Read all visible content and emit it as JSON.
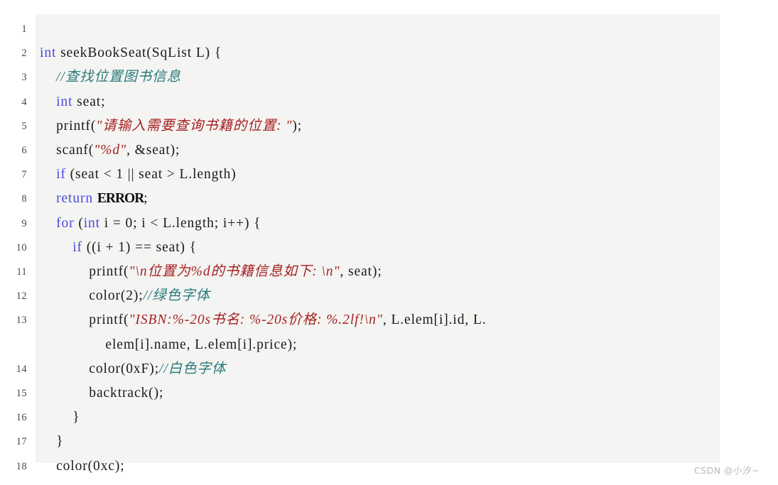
{
  "listing": {
    "language": "C",
    "background_color": "#f4f4f2",
    "gutter_color": "#4a4a4a",
    "colors": {
      "keyword": "#4a4ae0",
      "string": "#a52222",
      "comment": "#2a7a7a",
      "plain": "#1a1a1a"
    },
    "rows": [
      {
        "number": "1",
        "segments": []
      },
      {
        "number": "2",
        "segments": [
          {
            "cls": "kw",
            "text": "int"
          },
          {
            "cls": "plain",
            "text": " seekBookSeat(SqList L) {"
          }
        ]
      },
      {
        "number": "3",
        "segments": [
          {
            "cls": "plain",
            "text": "    "
          },
          {
            "cls": "cmt",
            "text": "//查找位置图书信息"
          }
        ]
      },
      {
        "number": "4",
        "segments": [
          {
            "cls": "plain",
            "text": "    "
          },
          {
            "cls": "kw",
            "text": "int"
          },
          {
            "cls": "plain",
            "text": " seat;"
          }
        ]
      },
      {
        "number": "5",
        "segments": [
          {
            "cls": "plain",
            "text": "    printf("
          },
          {
            "cls": "str",
            "text": "\"请输入需要查询书籍的位置: \""
          },
          {
            "cls": "plain",
            "text": ");"
          }
        ]
      },
      {
        "number": "6",
        "segments": [
          {
            "cls": "plain",
            "text": "    scanf("
          },
          {
            "cls": "str",
            "text": "\"%d\""
          },
          {
            "cls": "plain",
            "text": ", &seat);"
          }
        ]
      },
      {
        "number": "7",
        "segments": [
          {
            "cls": "plain",
            "text": "    "
          },
          {
            "cls": "kw",
            "text": "if"
          },
          {
            "cls": "plain",
            "text": " (seat < 1 || seat > L.length)"
          }
        ]
      },
      {
        "number": "8",
        "segments": [
          {
            "cls": "plain",
            "text": "    "
          },
          {
            "cls": "kw",
            "text": "return"
          },
          {
            "cls": "plain",
            "text": " "
          },
          {
            "cls": "mac",
            "text": "ERROR"
          },
          {
            "cls": "plain",
            "text": ";"
          }
        ]
      },
      {
        "number": "9",
        "segments": [
          {
            "cls": "plain",
            "text": "    "
          },
          {
            "cls": "kw",
            "text": "for"
          },
          {
            "cls": "plain",
            "text": " ("
          },
          {
            "cls": "kw",
            "text": "int"
          },
          {
            "cls": "plain",
            "text": " i = 0; i < L.length; i++) {"
          }
        ]
      },
      {
        "number": "10",
        "segments": [
          {
            "cls": "plain",
            "text": "        "
          },
          {
            "cls": "kw",
            "text": "if"
          },
          {
            "cls": "plain",
            "text": " ((i + 1) == seat) {"
          }
        ]
      },
      {
        "number": "11",
        "segments": [
          {
            "cls": "plain",
            "text": "            printf("
          },
          {
            "cls": "str",
            "text": "\"\\n位置为%d的书籍信息如下: \\n\""
          },
          {
            "cls": "plain",
            "text": ", seat);"
          }
        ]
      },
      {
        "number": "12",
        "segments": [
          {
            "cls": "plain",
            "text": "            color(2);"
          },
          {
            "cls": "cmt",
            "text": "//绿色字体"
          }
        ]
      },
      {
        "number": "13",
        "segments": [
          {
            "cls": "plain",
            "text": "            printf("
          },
          {
            "cls": "str",
            "text": "\"ISBN:%-20s书名: %-20s价格: %.2lf!\\n\""
          },
          {
            "cls": "plain",
            "text": ", L.elem[i].id, L."
          }
        ]
      },
      {
        "number": "",
        "segments": [
          {
            "cls": "plain",
            "text": "                elem[i].name, L.elem[i].price);"
          }
        ]
      },
      {
        "number": "14",
        "segments": [
          {
            "cls": "plain",
            "text": "            color(0xF);"
          },
          {
            "cls": "cmt",
            "text": "//白色字体"
          }
        ]
      },
      {
        "number": "15",
        "segments": [
          {
            "cls": "plain",
            "text": "            backtrack();"
          }
        ]
      },
      {
        "number": "16",
        "segments": [
          {
            "cls": "plain",
            "text": "        }"
          }
        ]
      },
      {
        "number": "17",
        "segments": [
          {
            "cls": "plain",
            "text": "    }"
          }
        ]
      },
      {
        "number": "18",
        "segments": [
          {
            "cls": "plain",
            "text": "    color(0xc);"
          }
        ]
      }
    ]
  },
  "watermark": {
    "text": "CSDN @小汐~"
  }
}
